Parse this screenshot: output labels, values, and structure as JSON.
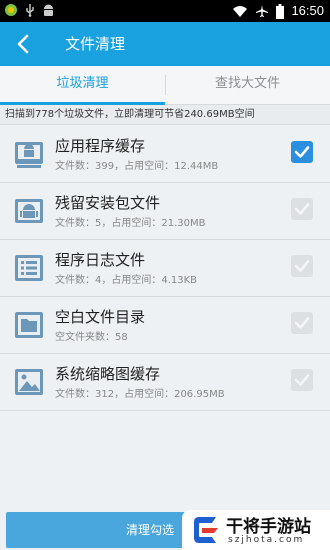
{
  "status_bar": {
    "time": "16:50",
    "icons": [
      "app-notification-icon",
      "usb-icon",
      "android-notification-icon",
      "wifi-icon",
      "airplane-icon",
      "battery-icon"
    ]
  },
  "header": {
    "title": "文件清理"
  },
  "tabs": [
    {
      "label": "垃圾清理",
      "active": true
    },
    {
      "label": "查找大文件",
      "active": false
    }
  ],
  "summary": "扫描到778个垃圾文件，立即清理可节省240.69MB空间",
  "items": [
    {
      "name": "应用程序缓存",
      "detail": "文件数：399，占用空间：12.44MB",
      "icon": "app-cache-icon",
      "checked": true
    },
    {
      "name": "残留安装包文件",
      "detail": "文件数：5，占用空间：21.30MB",
      "icon": "android-package-icon",
      "checked": true
    },
    {
      "name": "程序日志文件",
      "detail": "文件数：4，占用空间：4.13KB",
      "icon": "log-list-icon",
      "checked": true
    },
    {
      "name": "空白文件目录",
      "detail": "空文件夹数：58",
      "icon": "folder-icon",
      "checked": true
    },
    {
      "name": "系统缩略图缓存",
      "detail": "文件数：312，占用空间：206.95MB",
      "icon": "image-icon",
      "checked": true
    }
  ],
  "clean_button_label": "清理勾选",
  "watermark": {
    "title": "干将手游站",
    "url": "szjhota.com"
  },
  "colors": {
    "primary": "#1aa1e0",
    "check_on": "#2a8fe0",
    "check_disabled": "#dde0e3",
    "button": "#4aa7de"
  }
}
